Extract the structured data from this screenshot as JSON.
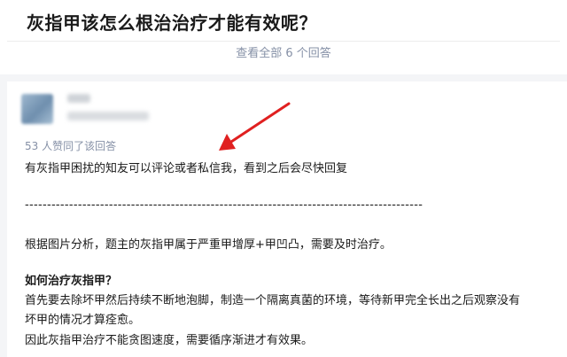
{
  "question": {
    "title": "灰指甲该怎么根治治疗才能有效呢？",
    "view_all": "查看全部 6 个回答"
  },
  "answer": {
    "votes": "53 人赞同了该回答",
    "lines": [
      "有灰指甲困扰的知友可以评论或者私信我，看到之后会尽快回复",
      "------------------------------------------------------------------------------------------",
      "根据图片分析，题主的灰指甲属于严重甲增厚+甲凹凸，需要及时治疗。",
      "如何治疗灰指甲？",
      "首先要去除坏甲然后持续不断地泡脚，制造一个隔离真菌的环境，等待新甲完全长出之后观察没有",
      "坏甲的情况才算痊愈。",
      "因此灰指甲治疗不能贪图速度，需要循序渐进才有效果。"
    ]
  },
  "annotation": {
    "arrow_color": "#e02020"
  },
  "colors": {
    "muted": "#8590a6",
    "text": "#1a1a1a",
    "card": "#ffffff",
    "page": "#f4f5f7"
  }
}
